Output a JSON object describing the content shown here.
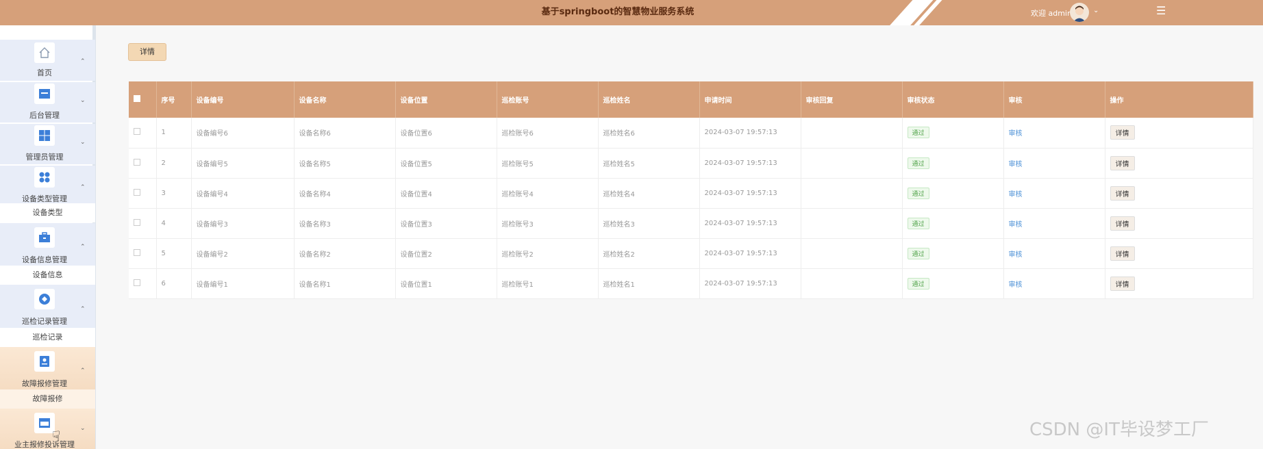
{
  "header": {
    "title": "基于springboot的智慧物业服务系统",
    "welcome": "欢迎 admin",
    "dropdown_icon": "chevron-down-icon",
    "menu_icon": "hamburger-icon"
  },
  "sidebar": {
    "items": [
      {
        "label": "首页",
        "icon": "home-icon"
      },
      {
        "label": "后台管理",
        "icon": "folder-icon"
      },
      {
        "label": "管理员管理",
        "icon": "grid-icon"
      },
      {
        "label": "设备类型管理",
        "icon": "dots-icon",
        "sub": "设备类型"
      },
      {
        "label": "设备信息管理",
        "icon": "briefcase-icon",
        "sub": "设备信息"
      },
      {
        "label": "巡检记录管理",
        "icon": "diamond-icon",
        "sub": "巡检记录"
      },
      {
        "label": "故障报修管理",
        "icon": "badge-icon",
        "sub": "故障报修"
      },
      {
        "label": "业主报修投诉管理",
        "icon": "card-icon"
      }
    ]
  },
  "toolbar": {
    "detail_label": "详情"
  },
  "table": {
    "headers": [
      "序号",
      "设备编号",
      "设备名称",
      "设备位置",
      "巡检账号",
      "巡检姓名",
      "申请时间",
      "审核回复",
      "审核状态",
      "审核",
      "操作"
    ],
    "rows": [
      {
        "no": "1",
        "code": "设备编号6",
        "name": "设备名称6",
        "location": "设备位置6",
        "account": "巡检账号6",
        "person": "巡检姓名6",
        "time": "2024-03-07 19:57:13",
        "reply": "",
        "status": "通过",
        "audit": "审核",
        "action": "详情"
      },
      {
        "no": "2",
        "code": "设备编号5",
        "name": "设备名称5",
        "location": "设备位置5",
        "account": "巡检账号5",
        "person": "巡检姓名5",
        "time": "2024-03-07 19:57:13",
        "reply": "",
        "status": "通过",
        "audit": "审核",
        "action": "详情"
      },
      {
        "no": "3",
        "code": "设备编号4",
        "name": "设备名称4",
        "location": "设备位置4",
        "account": "巡检账号4",
        "person": "巡检姓名4",
        "time": "2024-03-07 19:57:13",
        "reply": "",
        "status": "通过",
        "audit": "审核",
        "action": "详情"
      },
      {
        "no": "4",
        "code": "设备编号3",
        "name": "设备名称3",
        "location": "设备位置3",
        "account": "巡检账号3",
        "person": "巡检姓名3",
        "time": "2024-03-07 19:57:13",
        "reply": "",
        "status": "通过",
        "audit": "审核",
        "action": "详情"
      },
      {
        "no": "5",
        "code": "设备编号2",
        "name": "设备名称2",
        "location": "设备位置2",
        "account": "巡检账号2",
        "person": "巡检姓名2",
        "time": "2024-03-07 19:57:13",
        "reply": "",
        "status": "通过",
        "audit": "审核",
        "action": "详情"
      },
      {
        "no": "6",
        "code": "设备编号1",
        "name": "设备名称1",
        "location": "设备位置1",
        "account": "巡检账号1",
        "person": "巡检姓名1",
        "time": "2024-03-07 19:57:13",
        "reply": "",
        "status": "通过",
        "audit": "审核",
        "action": "详情"
      }
    ]
  },
  "watermark": "CSDN @IT毕设梦工厂",
  "colors": {
    "header": "#d6a07a",
    "icon_blue": "#3c7fd8",
    "status_green": "#52a44b",
    "link": "#4a8fd6"
  }
}
